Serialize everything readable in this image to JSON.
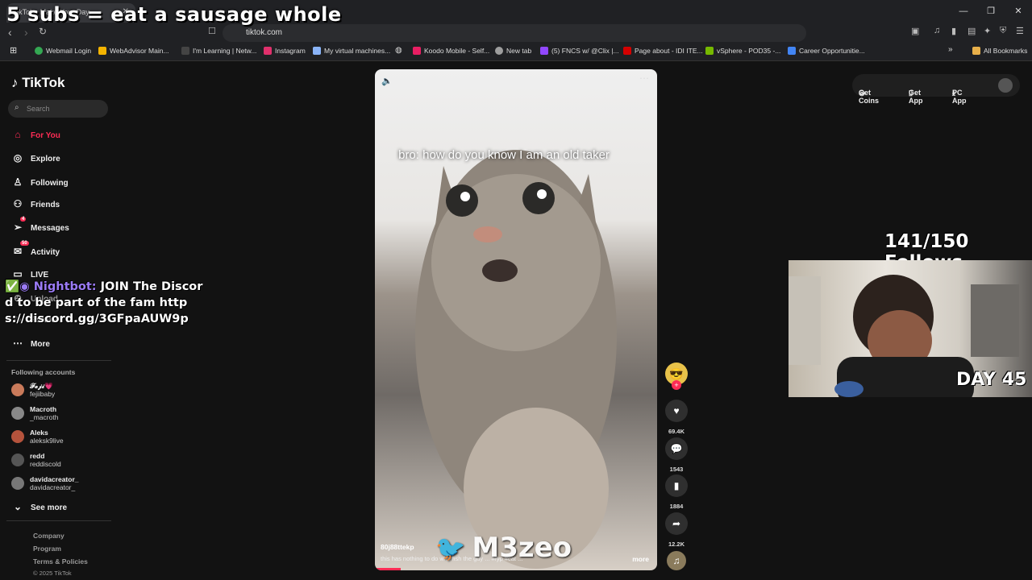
{
  "browser": {
    "tab_title": "TikTok - Make Your Day",
    "url": "tiktok.com",
    "bookmarks": [
      "Webmail Login",
      "WebAdvisor Main...",
      "I'm Learning | Netw...",
      "Instagram",
      "My virtual machines...",
      "Koodo Mobile - Self...",
      "New tab",
      "(5) FNCS w/ @Clix |...",
      "Page about - IDI ITE...",
      "vSphere - POD35 -...",
      "Career Opportunitie..."
    ],
    "all_bookmarks": "All Bookmarks",
    "bookmark_colors": [
      "#34a853",
      "#f4b400",
      "#444444",
      "#e1306c",
      "#8ab4f8",
      "#e91e63",
      "#9e9e9e",
      "#9147ff",
      "#d50000",
      "#76b900",
      "#4285f4"
    ]
  },
  "stream_overlay": {
    "title": "5 subs = eat a sausage whole",
    "follows": "141/150 Follows",
    "day": "DAY 45",
    "nightbot_name": "Nightbot:",
    "nightbot_message": "JOIN The Discord to be part of the fam https://discord.gg/3GFpaAUW9p",
    "watermark": "M3zeo"
  },
  "sidebar": {
    "logo": "TikTok",
    "search_placeholder": "Search",
    "nav": [
      {
        "label": "For You",
        "icon": "home-icon",
        "active": true
      },
      {
        "label": "Explore",
        "icon": "compass-icon"
      },
      {
        "label": "Following",
        "icon": "following-icon"
      },
      {
        "label": "Friends",
        "icon": "friends-icon"
      },
      {
        "label": "Messages",
        "icon": "messages-icon",
        "badge": "4"
      },
      {
        "label": "Activity",
        "icon": "activity-icon",
        "badge": "50"
      },
      {
        "label": "LIVE",
        "icon": "live-icon"
      },
      {
        "label": "Upload",
        "icon": "upload-icon"
      },
      {
        "label": "Profile",
        "icon": "profile-icon"
      },
      {
        "label": "More",
        "icon": "more-icon"
      }
    ],
    "following_header": "Following accounts",
    "accounts": [
      {
        "name": "𝓕𝓮𝓳𝓲💗",
        "handle": "fejiibaby"
      },
      {
        "name": "Macroth",
        "handle": "_macroth"
      },
      {
        "name": "Aleks",
        "handle": "aleksk9live"
      },
      {
        "name": "redd",
        "handle": "reddiscold"
      },
      {
        "name": "davidacreator_",
        "handle": "davidacreator_"
      }
    ],
    "see_more": "See more",
    "footer": [
      "Company",
      "Program",
      "Terms & Policies",
      "© 2025 TikTok"
    ]
  },
  "video": {
    "caption": "bro: how do you know I am an old taker",
    "author": "80j88ttekp",
    "description": "this has nothing to do with fish the guy ... #fyp #cat ...",
    "more": "more",
    "likes": "69.4K",
    "comments": "1543",
    "saves": "1884",
    "shares": "12.2K"
  },
  "topbar": {
    "get_coins": "Get Coins",
    "get_app": "Get App",
    "pc_app": "PC App"
  },
  "colors": {
    "accent": "#fe2c55",
    "nightbot": "#9b7bf5",
    "twitter": "#1da1f2"
  }
}
